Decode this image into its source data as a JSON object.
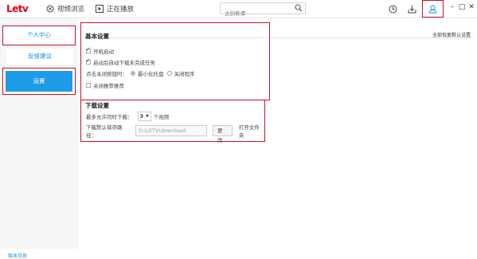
{
  "header": {
    "logo": "Letv",
    "nav_items": [
      {
        "label": "视频浏览",
        "icon": "browse-icon"
      },
      {
        "label": "正在播放",
        "icon": "play-icon"
      }
    ],
    "search_placeholder": "古剑奇谭",
    "toolbar_icons": [
      "history-icon",
      "download-icon",
      "user-icon"
    ],
    "window_controls": {
      "minimize": "–",
      "maximize": "□",
      "close": "✕"
    }
  },
  "sidebar": {
    "items": [
      {
        "label": "个人中心"
      },
      {
        "label": "反馈建议"
      },
      {
        "label": "设置",
        "active": true
      }
    ],
    "version_label": "版本信息"
  },
  "basic_settings": {
    "title": "基本设置",
    "restore_label": "全部恢复默认设置",
    "auto_start_label": "开机启动",
    "auto_start_checked": true,
    "resume_download_label": "启动后自动下载未完成任务",
    "resume_download_checked": true,
    "close_action_label": "点击关闭按钮时：",
    "close_options": [
      {
        "label": "最小化托盘",
        "selected": true
      },
      {
        "label": "关闭程序",
        "selected": false
      }
    ],
    "close_pinned_label": "关闭推荐推荐",
    "close_pinned_checked": false
  },
  "download_settings": {
    "title": "下载设置",
    "max_concurrent_label": "最多允许同时下载：",
    "max_concurrent_value": "3",
    "max_concurrent_unit": "个视频",
    "default_path_label": "下载默认保存路径：",
    "default_path_value": "D:\\LETV\\download",
    "change_button": "更改",
    "open_folder_label": "打开文件夹"
  },
  "accent_colors": {
    "brand": "#e60012",
    "primary": "#1e9be8",
    "highlight": "#c8102e"
  }
}
